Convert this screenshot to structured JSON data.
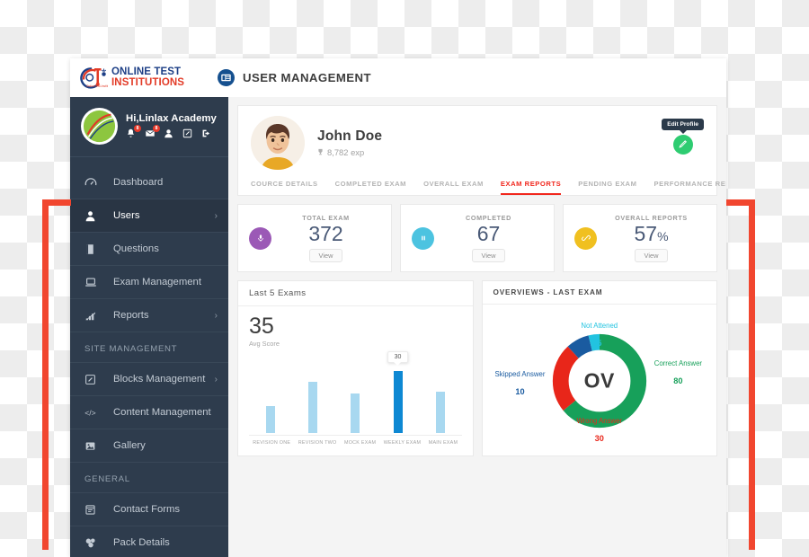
{
  "brand": {
    "line1": "ONLINE TEST",
    "line2": "INSTITUTIONS",
    "mark_icon": "ot-logo-icon",
    "color_navy": "#1d3f86",
    "color_red": "#e23a26"
  },
  "header": {
    "icon": "list-card-icon",
    "title": "USER MANAGEMENT"
  },
  "sidebar": {
    "user": {
      "greeting": "Hi,Linlax Academy",
      "avatar_icon": "academy-logo-avatar",
      "icons": [
        {
          "name": "bell-icon",
          "badge": "8"
        },
        {
          "name": "envelope-icon",
          "badge": "8"
        },
        {
          "name": "user-icon",
          "badge": ""
        },
        {
          "name": "edit-square-icon",
          "badge": ""
        },
        {
          "name": "logout-icon",
          "badge": ""
        }
      ]
    },
    "items": [
      {
        "label": "Dashboard",
        "icon": "speedometer-icon",
        "chevron": "",
        "active": false
      },
      {
        "label": "Users",
        "icon": "user-icon",
        "chevron": "›",
        "active": true
      },
      {
        "label": "Questions",
        "icon": "book-icon",
        "chevron": "",
        "active": false
      },
      {
        "label": "Exam Management",
        "icon": "laptop-icon",
        "chevron": "",
        "active": false
      },
      {
        "label": "Reports",
        "icon": "bar-chart-icon",
        "chevron": "›",
        "active": false
      }
    ],
    "section_site": "SITE MANAGEMENT",
    "site_items": [
      {
        "label": "Blocks Management",
        "icon": "pencil-square-icon",
        "chevron": "›"
      },
      {
        "label": "Content Management",
        "icon": "code-icon",
        "chevron": ""
      },
      {
        "label": "Gallery",
        "icon": "image-icon",
        "chevron": ""
      }
    ],
    "section_general": "GENERAL",
    "general_items": [
      {
        "label": "Contact Forms",
        "icon": "form-icon",
        "chevron": ""
      },
      {
        "label": "Pack Details",
        "icon": "package-icon",
        "chevron": ""
      }
    ]
  },
  "profile": {
    "avatar_icon": "male-avatar-illustration",
    "name": "John Doe",
    "exp_icon": "trophy-icon",
    "exp": "8,782 exp",
    "edit_tooltip": "Edit Profile",
    "edit_icon": "pencil-icon",
    "tabs": [
      {
        "label": "COURCE DETAILS",
        "active": false
      },
      {
        "label": "COMPLETED EXAM",
        "active": false
      },
      {
        "label": "OVERALL EXAM",
        "active": false
      },
      {
        "label": "EXAM REPORTS",
        "active": true
      },
      {
        "label": "PENDING EXAM",
        "active": false
      },
      {
        "label": "PERFORMANCE REPORTS",
        "active": false
      }
    ]
  },
  "stats": [
    {
      "label": "TOTAL EXAM",
      "value": "372",
      "suffix": "",
      "view": "View",
      "icon": "microphone-icon",
      "color": "#9b59b6"
    },
    {
      "label": "COMPLETED",
      "value": "67",
      "suffix": "",
      "view": "View",
      "icon": "pause-icon",
      "color": "#4cc3e0"
    },
    {
      "label": "OVERALL REPORTS",
      "value": "57",
      "suffix": "%",
      "view": "View",
      "icon": "link-icon",
      "color": "#f0c020"
    }
  ],
  "bar_panel": {
    "title": "Last 5 Exams",
    "avg_value": "35",
    "avg_label": "Avg Score"
  },
  "donut_panel": {
    "title": "OVERVIEWS - LAST EXAM",
    "center_label": "OV"
  },
  "chart_data": [
    {
      "type": "bar",
      "title": "Last 5 Exams",
      "categories": [
        "REVISION ONE",
        "REVISION TWO",
        "MOCK EXAM",
        "WEEKLY EXAM",
        "MAIN EXAM"
      ],
      "values": [
        13,
        25,
        19,
        30,
        20
      ],
      "highlight_index": 3,
      "highlight_tooltip": "30",
      "bar_color": "#a8d8f0",
      "highlight_color": "#0e88d3",
      "xlabel": "",
      "ylabel": "",
      "ylim": [
        0,
        34
      ],
      "grid": false,
      "legend": "none",
      "annotations": [
        {
          "text": "35",
          "label": "Avg Score"
        }
      ]
    },
    {
      "type": "pie",
      "title": "OVERVIEWS - LAST EXAM",
      "center_label": "OV",
      "labels": [
        "Correct Answer",
        "Wrong Answer",
        "Skipped Answer",
        "Not Attened"
      ],
      "values": [
        80,
        30,
        10,
        5
      ],
      "colors": [
        "#17a05a",
        "#e8261a",
        "#1a5ba0",
        "#22c3e0"
      ],
      "legend": "around-chart"
    }
  ],
  "annotation": {
    "bracket_color": "#f1462f"
  }
}
